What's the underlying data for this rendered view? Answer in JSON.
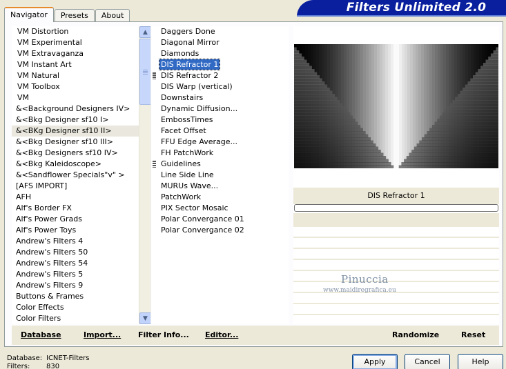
{
  "tabs": [
    "Navigator",
    "Presets",
    "About"
  ],
  "banner_title": "Filters Unlimited 2.0",
  "categories": [
    "VM Distortion",
    "VM Experimental",
    "VM Extravaganza",
    "VM Instant Art",
    "VM Natural",
    "VM Toolbox",
    "VM",
    "&<Background Designers IV>",
    "&<Bkg Designer sf10 I>",
    "&<BKg Designer sf10 II>",
    "&<Bkg Designer sf10 III>",
    "&<Bkg Designers sf10 IV>",
    "&<Bkg Kaleidoscope>",
    "&<Sandflower Specials\"v\" >",
    "[AFS IMPORT]",
    "AFH",
    "Alf's Border FX",
    "Alf's Power Grads",
    "Alf's Power Toys",
    "Andrew's Filters 4",
    "Andrew's Filters 50",
    "Andrew's Filters 54",
    "Andrew's Filters 5",
    "Andrew's Filters 9",
    "Buttons & Frames",
    "Color Effects",
    "Color Filters"
  ],
  "filters": [
    "Daggers Done",
    "Diagonal Mirror",
    "Diamonds",
    "DIS Refractor 1",
    "DIS Refractor 2",
    "DIS Warp (vertical)",
    "Downstairs",
    "Dynamic Diffusion...",
    "EmbossTimes",
    "Facet Offset",
    "FFU Edge Average...",
    "FH PatchWork",
    "Guidelines",
    "Line Side Line",
    "MURUs Wave...",
    "PatchWork",
    "PIX Sector Mosaic",
    "Polar Convergance 01",
    "Polar Convergance 02"
  ],
  "selected_filter_name": "DIS Refractor 1",
  "progress": 0,
  "watermark": {
    "line1": "Pinuccia",
    "line2": "www.maidiregrafica.eu"
  },
  "bottom_buttons": {
    "database": "Database",
    "import": "Import...",
    "filter_info": "Filter Info...",
    "editor": "Editor...",
    "randomize": "Randomize",
    "reset": "Reset"
  },
  "status": {
    "database_label": "Database:",
    "database_value": "ICNET-Filters",
    "filters_label": "Filters:",
    "filters_value": "830"
  },
  "dialog_buttons": {
    "apply": "Apply",
    "cancel": "Cancel",
    "help": "Help"
  },
  "icons": {
    "scroll_up": "up-arrow-icon",
    "scroll_down": "down-arrow-icon"
  }
}
